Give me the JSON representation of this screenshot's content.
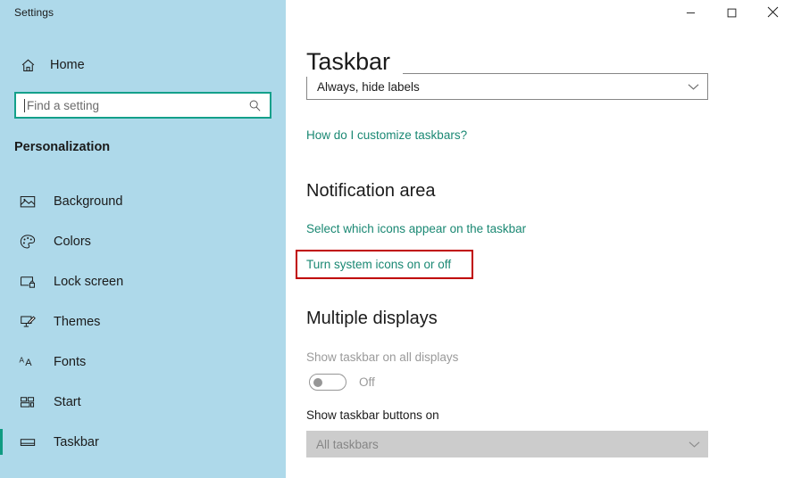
{
  "window": {
    "app_title": "Settings",
    "controls": [
      {
        "name": "minimize",
        "glyph": "minimize-icon",
        "label": "Minimize"
      },
      {
        "name": "maximize",
        "glyph": "maximize-icon",
        "label": "Maximize"
      },
      {
        "name": "close",
        "glyph": "close-icon",
        "label": "Close"
      }
    ]
  },
  "sidebar": {
    "home_label": "Home",
    "home_icon": "home-icon",
    "search": {
      "placeholder": "Find a setting",
      "value": "",
      "icon": "search-icon"
    },
    "category_heading": "Personalization",
    "items": [
      {
        "label": "Background",
        "icon": "picture-icon",
        "selected": false
      },
      {
        "label": "Colors",
        "icon": "palette-icon",
        "selected": false
      },
      {
        "label": "Lock screen",
        "icon": "lock-screen-icon",
        "selected": false
      },
      {
        "label": "Themes",
        "icon": "theme-brush-icon",
        "selected": false
      },
      {
        "label": "Fonts",
        "icon": "fonts-aa-icon",
        "selected": false
      },
      {
        "label": "Start",
        "icon": "start-tiles-icon",
        "selected": false
      },
      {
        "label": "Taskbar",
        "icon": "taskbar-icon",
        "selected": true
      }
    ]
  },
  "main": {
    "page_title": "Taskbar",
    "taskbar_buttons_combine": {
      "value": "Always, hide labels",
      "chevron": "chevron-down-icon",
      "enabled": true
    },
    "customize_link": "How do I customize taskbars?",
    "notification_area": {
      "heading": "Notification area",
      "links": [
        "Select which icons appear on the taskbar",
        "Turn system icons on or off"
      ]
    },
    "multiple_displays": {
      "heading": "Multiple displays",
      "show_taskbar_all_displays": {
        "label": "Show taskbar on all displays",
        "state": "Off",
        "enabled": false
      },
      "show_taskbar_buttons_on": {
        "label": "Show taskbar buttons on",
        "value": "All taskbars",
        "chevron": "chevron-down-icon",
        "enabled": false
      }
    }
  },
  "annotation": {
    "highlight_target": "Turn system icons on or off",
    "color": "#c00000"
  },
  "colors": {
    "sidebar_bg": "#aed9ea",
    "accent_teal": "#0f9b82",
    "link_teal": "#1a8873",
    "highlight_red": "#c00000",
    "disabled_gray": "#cccccc"
  }
}
